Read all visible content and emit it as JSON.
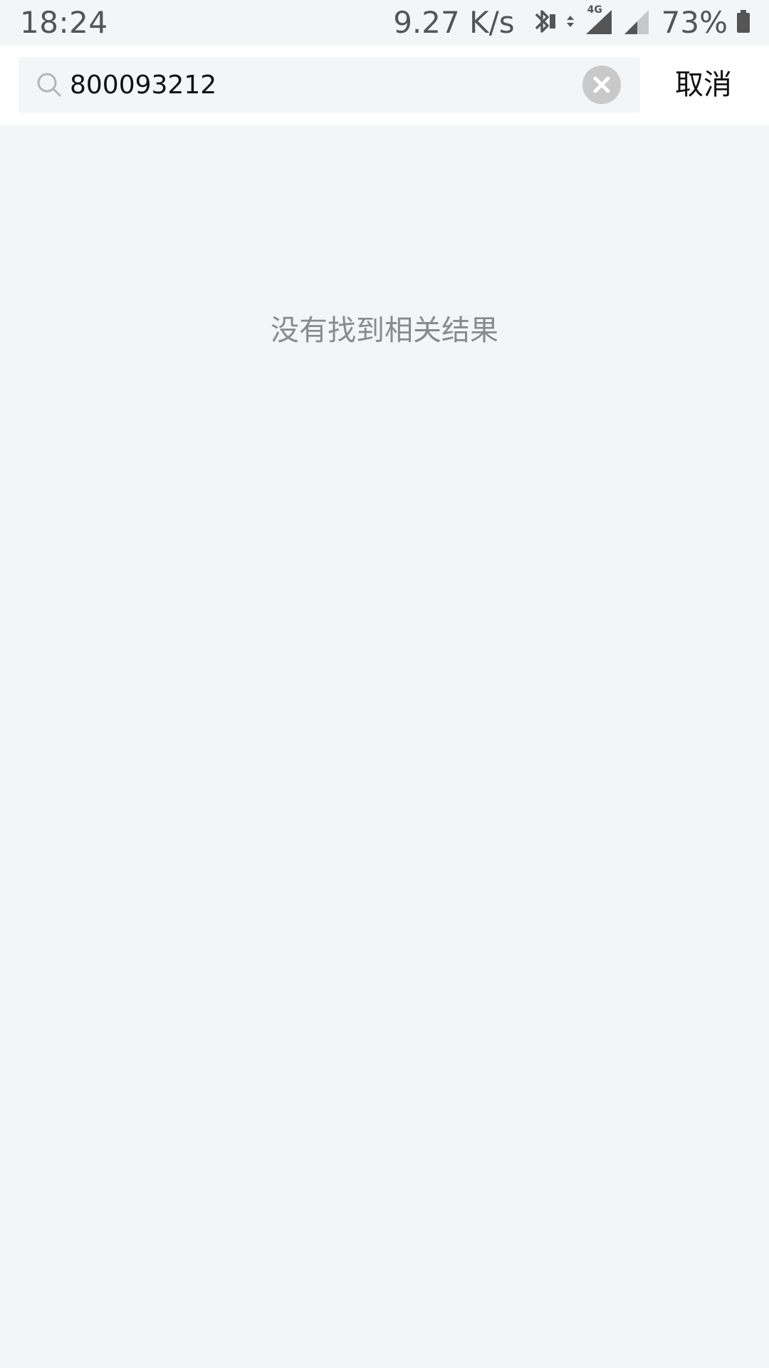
{
  "status_bar": {
    "time": "18:24",
    "network_speed": "9.27 K/s",
    "icons": [
      "bluetooth-icon",
      "data-arrows-icon",
      "signal-4g-icon",
      "signal-icon",
      "battery-icon"
    ],
    "network_type": "4G",
    "battery_percent": "73%"
  },
  "search": {
    "query": "800093212",
    "cancel_label": "取消"
  },
  "results": {
    "empty_message": "没有找到相关结果"
  },
  "colors": {
    "background": "#f4f5f7",
    "header": "#ffffff",
    "empty_text": "#8a8a8a",
    "clear_button": "#c9c9c9"
  }
}
